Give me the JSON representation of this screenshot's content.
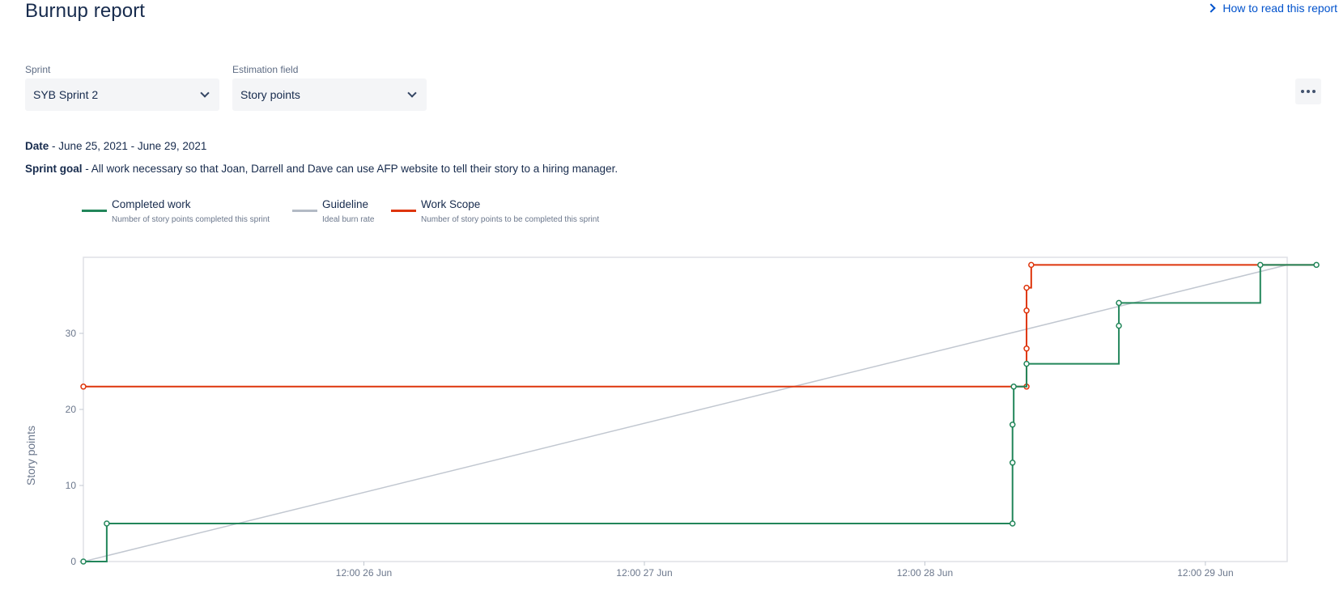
{
  "header": {
    "title": "Burnup report",
    "help_link": "How to read this report"
  },
  "filters": {
    "sprint_label": "Sprint",
    "sprint_value": "SYB Sprint 2",
    "estimation_label": "Estimation field",
    "estimation_value": "Story points"
  },
  "info": {
    "date_label": "Date",
    "date_value": " - June 25, 2021 - June 29, 2021",
    "goal_label": "Sprint goal",
    "goal_value": " - All work necessary so that Joan, Darrell and Dave can use AFP website to tell their story to a hiring manager."
  },
  "legend": [
    {
      "name": "Completed work",
      "desc": "Number of story points completed this sprint",
      "color": "#22865a"
    },
    {
      "name": "Guideline",
      "desc": "Ideal burn rate",
      "color": "#b3bac5"
    },
    {
      "name": "Work Scope",
      "desc": "Number of story points to be completed this sprint",
      "color": "#de350b"
    }
  ],
  "chart_data": {
    "type": "line",
    "ylabel": "Story points",
    "xlabel": "",
    "x_unit": "hours from 25 Jun 00:00",
    "xlim": [
      12,
      115
    ],
    "ylim": [
      0,
      40
    ],
    "yticks": [
      0,
      10,
      20,
      30
    ],
    "xticks": [
      {
        "x": 36,
        "label": "12:00 26 Jun"
      },
      {
        "x": 60,
        "label": "12:00 27 Jun"
      },
      {
        "x": 84,
        "label": "12:00 28 Jun"
      },
      {
        "x": 108,
        "label": "12:00 29 Jun"
      }
    ],
    "grid": false,
    "series": [
      {
        "name": "Completed work",
        "color": "#22865a",
        "step": true,
        "points": [
          [
            12,
            0
          ],
          [
            14,
            5
          ],
          [
            91.5,
            5
          ],
          [
            91.5,
            13
          ],
          [
            91.5,
            18
          ],
          [
            91.6,
            23
          ],
          [
            92.7,
            26
          ],
          [
            100.6,
            31
          ],
          [
            100.6,
            34
          ],
          [
            112.7,
            39
          ],
          [
            117.5,
            39
          ]
        ]
      },
      {
        "name": "Work Scope",
        "color": "#de350b",
        "step": true,
        "points": [
          [
            12,
            23
          ],
          [
            92.7,
            23
          ],
          [
            92.7,
            28
          ],
          [
            92.7,
            33
          ],
          [
            92.7,
            36
          ],
          [
            93.1,
            39
          ],
          [
            117.5,
            39
          ]
        ]
      },
      {
        "name": "Guideline",
        "color": "#c1c7d0",
        "step": false,
        "points": [
          [
            12,
            0
          ],
          [
            115,
            39
          ]
        ]
      }
    ]
  }
}
